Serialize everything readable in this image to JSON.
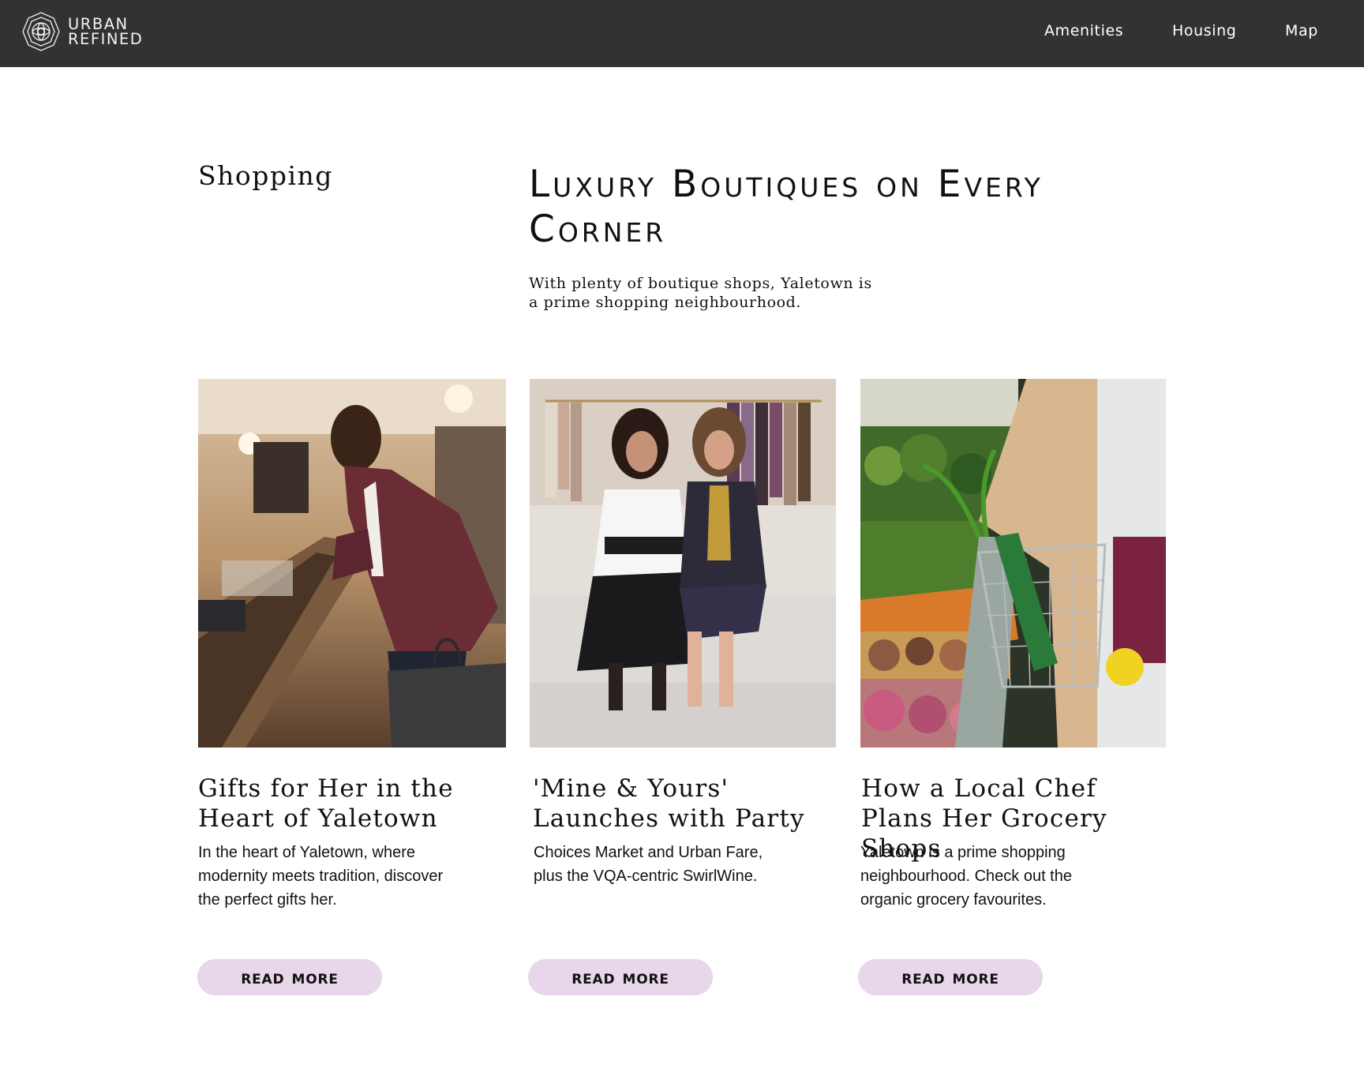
{
  "header": {
    "brand": {
      "line1": "URBAN",
      "line2": "REFINED",
      "logo_icon": "rose-emblem-icon"
    },
    "nav": [
      {
        "label": "Amenities"
      },
      {
        "label": "Housing"
      },
      {
        "label": "Map"
      }
    ],
    "background": "#323232"
  },
  "intro": {
    "section_label": "Shopping",
    "headline": "Luxury Boutiques on Every Corner",
    "lede": "With plenty of boutique shops, Yaletown is a prime shopping neighbourhood."
  },
  "cards": [
    {
      "image_subject": "man-shopping-at-jewelry-counter",
      "title": "Gifts for Her in the Heart of Yaletown",
      "description": "In the heart of Yaletown, where modernity meets tradition, discover the perfect gifts her.",
      "button": "Read More"
    },
    {
      "image_subject": "two-women-on-sofa-in-boutique",
      "title": "'Mine & Yours' Launches with Party",
      "description": "Choices Market and Urban Fare, plus the VQA-centric SwirlWine.",
      "button": "Read More"
    },
    {
      "image_subject": "grocery-basket-with-produce",
      "title": "How a Local Chef Plans Her Grocery Shops",
      "description": "Yaletown is a prime shopping neighbourhood. Check out the organic grocery favourites.",
      "button": "Read More"
    }
  ],
  "colors": {
    "header_bg": "#323232",
    "button_bg": "#e8d6ea",
    "text": "#111111"
  }
}
